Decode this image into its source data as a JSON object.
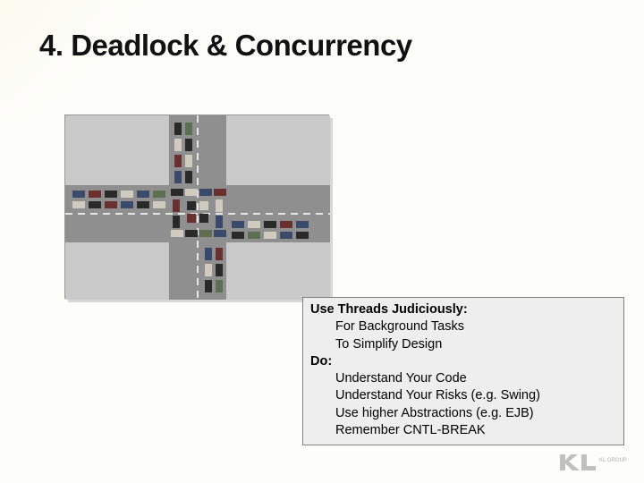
{
  "title": "4.  Deadlock & Concurrency",
  "box": {
    "h1": "Use Threads Judiciously:",
    "l1": "For Background Tasks",
    "l2": "To Simplify Design",
    "h2": "Do:",
    "l3": "Understand Your Code",
    "l4": "Understand Your Risks (e.g. Swing)",
    "l5": "Use higher Abstractions (e.g. EJB)",
    "l6": "Remember CNTL-BREAK"
  },
  "figure_alt": "Aerial photo of a gridlocked road intersection (traffic deadlock)",
  "logo_text": "KL GROUP"
}
